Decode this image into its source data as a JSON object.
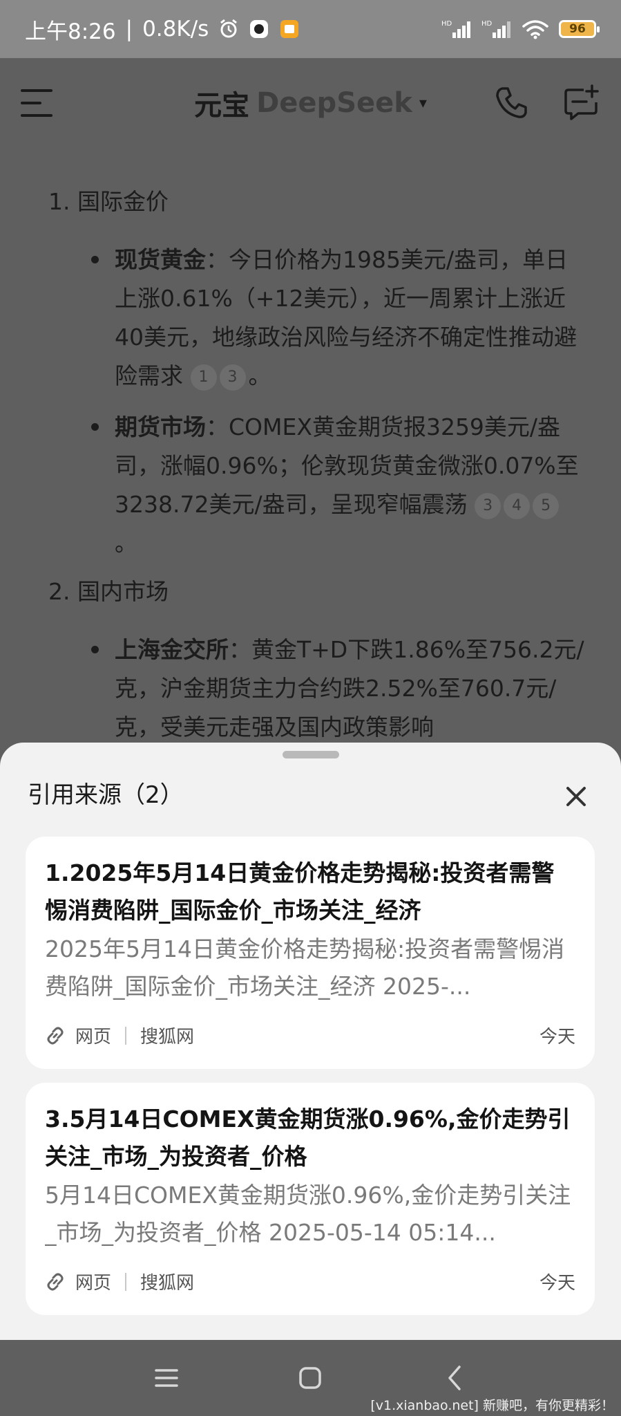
{
  "status_bar": {
    "time": "上午8:26",
    "speed": "0.8K/s",
    "signal_label": "HD",
    "battery": "96",
    "icons": [
      "alarm-icon",
      "camera-app-icon",
      "notes-app-icon",
      "signal-icon",
      "wifi-icon",
      "battery-icon"
    ]
  },
  "header": {
    "brand": "元宝",
    "model": "DeepSeek",
    "caret": "▾",
    "icons": [
      "menu-icon",
      "phone-icon",
      "new-chat-icon"
    ]
  },
  "content": {
    "sections": [
      {
        "heading": "1. 国际金价",
        "bullets": [
          {
            "label": "现货黄金",
            "text": "：今日价格为1985美元/盎司，单日上涨0.61%（+12美元），近一周累计上涨近40美元，地缘政治风险与经济不确定性推动避险需求",
            "citations": [
              "1",
              "3"
            ],
            "end": "。"
          },
          {
            "label": "期货市场",
            "text": "：COMEX黄金期货报3259美元/盎司，涨幅0.96%；伦敦现货黄金微涨0.07%至3238.72美元/盎司，呈现窄幅震荡",
            "citations": [
              "3",
              "4",
              "5"
            ],
            "end": "。"
          }
        ]
      },
      {
        "heading": "2. 国内市场",
        "bullets": [
          {
            "label": "上海金交所",
            "text": "：黄金T+D下跌1.86%至756.2元/克，沪金期货主力合约跌2.52%至760.7元/克，受美元走强及国内政策影响"
          }
        ]
      }
    ]
  },
  "sheet": {
    "title": "引用来源（2）",
    "cards": [
      {
        "title": "1.2025年5月14日黄金价格走势揭秘:投资者需警惕消费陷阱_国际金价_市场关注_经济",
        "snippet": "2025年5月14日黄金价格走势揭秘:投资者需警惕消费陷阱_国际金价_市场关注_经济 2025-...",
        "type": "网页",
        "source": "搜狐网",
        "date": "今天"
      },
      {
        "title": "3.5月14日COMEX黄金期货涨0.96%,金价走势引关注_市场_为投资者_价格",
        "snippet": "5月14日COMEX黄金期货涨0.96%,金价走势引关注_市场_为投资者_价格 2025-05-14 05:14...",
        "type": "网页",
        "source": "搜狐网",
        "date": "今天"
      }
    ]
  },
  "navbar": {
    "watermark": "[v1.xianbao.net] 新赚吧，有你更精彩！"
  }
}
